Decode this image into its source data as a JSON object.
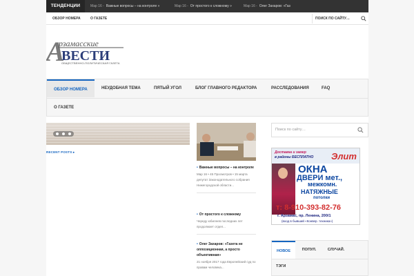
{
  "colors": {
    "accent": "#1565c0",
    "topbar": "#333333",
    "logo_gray": "#7a7a7a",
    "logo_blue": "#2c3e7a"
  },
  "topbar": {
    "trending_label": "ТЕНДЕНЦИИ",
    "items": [
      {
        "date": "Мар 16 -",
        "text": "Важные вопросы – на контроле »"
      },
      {
        "date": "Мар 16 -",
        "text": "От простого к сложному »"
      },
      {
        "date": "Мар 16 -",
        "text": "Олег Захаров: «Газ"
      }
    ]
  },
  "subnav": {
    "links": [
      "ОБЗОР НОМЕРА",
      "О ГАЗЕТЕ"
    ],
    "search_placeholder": "ПОИСК ПО САЙТУ…",
    "search_icon": "search-icon"
  },
  "logo": {
    "line1": "рзамасские",
    "line2": "ВЕСТИ",
    "letter": "А",
    "tagline": "ОБЩЕСТВЕННО-ПОЛИТИЧЕСКАЯ ГАЗЕТА"
  },
  "mainnav": {
    "items": [
      "ОБЗОР НОМЕРА",
      "НЕУДОБНАЯ ТЕМА",
      "ПЯТЫЙ УГОЛ",
      "БЛОГ ГЛАВНОГО РЕДАКТОРА",
      "РАССЛЕДОВАНИЯ",
      "FAQ",
      "О ГАЗЕТЕ"
    ],
    "active_index": 0
  },
  "slider": {
    "slide_count": 3
  },
  "recent_posts_label": "RECENT POSTS",
  "posts": [
    {
      "title": "Важные вопросы – на контроле",
      "meta": "Мар 16 • 45 Просмотров • 15 марта депутат Законодательного собрания Нижегородской области..."
    },
    {
      "title": "От простого к сложному",
      "meta": "Череду юбилеев последних лет продолжает отдел..."
    },
    {
      "title": "Олег Захаров: «Газета не оппозиционная, а просто объективная»",
      "meta": "21 ноября 2017 года Европейский суд по правам человека..."
    }
  ],
  "sidebar": {
    "search_placeholder": "Поиск по сайту…",
    "ad": {
      "line1": "Доставка и замер",
      "line2": "в районы БЕСПЛАТНО",
      "brand": "Элит",
      "w1": "ОКНА",
      "w2": "ДВЕРИ мет.,",
      "w3": "межкомн.",
      "w4": "НАТЯЖНЫЕ",
      "w5": "потолки",
      "phone": "т: 8-910-393-82-76",
      "address": "г. Арзамас, пр. Ленина, 200/1",
      "address2": "(вход в бывший «Конвер. техника»)"
    },
    "tabs": [
      "НОВОЕ",
      "ПОПУЛ.",
      "СЛУЧАЙ."
    ],
    "tab_active": 0,
    "tags_label": "ТЭГИ"
  }
}
